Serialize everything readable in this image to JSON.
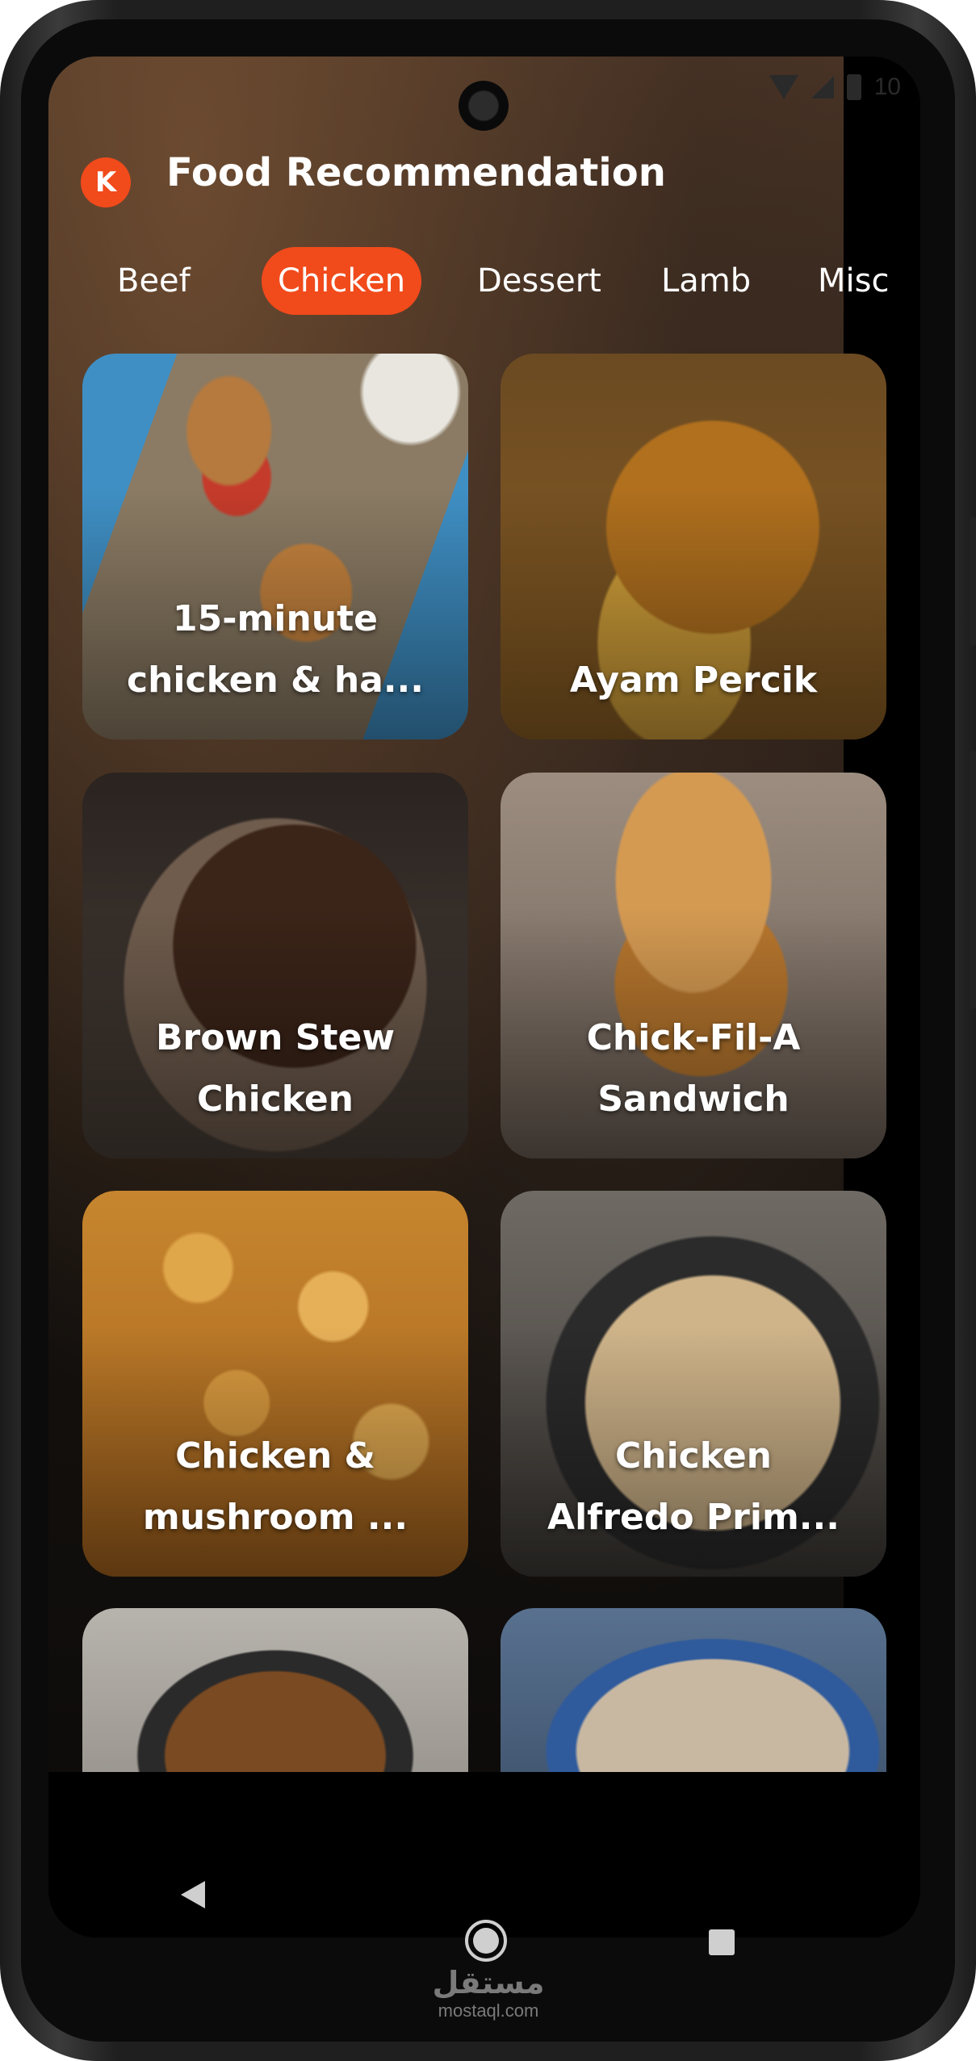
{
  "status_bar": {
    "time": "10"
  },
  "header": {
    "back_icon": "K",
    "title": "Food Recommendation"
  },
  "tabs": [
    {
      "label": "Beef"
    },
    {
      "label": "Chicken",
      "selected": true
    },
    {
      "label": "Dessert"
    },
    {
      "label": "Lamb"
    },
    {
      "label": "Misc"
    }
  ],
  "meals": [
    {
      "line1": "15-minute",
      "line2": "chicken & ha..."
    },
    {
      "line1": "",
      "line2": "Ayam Percik"
    },
    {
      "line1": "Brown Stew",
      "line2": "Chicken"
    },
    {
      "line1": "Chick-Fil-A",
      "line2": "Sandwich"
    },
    {
      "line1": "Chicken &",
      "line2": "mushroom ..."
    },
    {
      "line1": "Chicken",
      "line2": "Alfredo Prim..."
    },
    {
      "line1": "",
      "line2": ""
    },
    {
      "line1": "",
      "line2": ""
    }
  ],
  "watermark": {
    "arabic": "مستقل",
    "latin": "mostaql.com"
  },
  "colors": {
    "accent": "#f14a1b",
    "text": "#ffffff",
    "background": "#000000"
  }
}
